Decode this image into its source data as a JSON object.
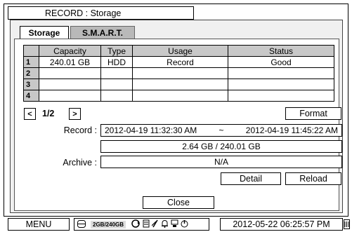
{
  "window": {
    "title": "RECORD : Storage"
  },
  "tabs": [
    {
      "label": "Storage",
      "active": true
    },
    {
      "label": "S.M.A.R.T.",
      "active": false
    }
  ],
  "table": {
    "headers": [
      "Capacity",
      "Type",
      "Usage",
      "Status"
    ],
    "rows": [
      {
        "index": "1",
        "capacity": "240.01 GB",
        "type": "HDD",
        "usage": "Record",
        "status": "Good"
      },
      {
        "index": "2",
        "capacity": "",
        "type": "",
        "usage": "",
        "status": ""
      },
      {
        "index": "3",
        "capacity": "",
        "type": "",
        "usage": "",
        "status": ""
      },
      {
        "index": "4",
        "capacity": "",
        "type": "",
        "usage": "",
        "status": ""
      }
    ]
  },
  "pagination": {
    "prev": "<",
    "page": "1/2",
    "next": ">"
  },
  "format_button": "Format",
  "record": {
    "label": "Record :",
    "start": "2012-04-19 11:32:30 AM",
    "separator": "~",
    "end": "2012-04-19 11:45:22 AM",
    "usage": "2.64 GB / 240.01 GB"
  },
  "archive": {
    "label": "Archive :",
    "value": "N/A"
  },
  "buttons": {
    "detail": "Detail",
    "reload": "Reload",
    "close": "Close"
  },
  "statusbar": {
    "menu": "MENU",
    "hdd_text": "2GB/240GB",
    "datetime": "2012-05-22 06:25:57 PM",
    "icons": [
      "hdd-icon",
      "network-icon",
      "record-icon",
      "mute-icon",
      "alarm-icon",
      "backup-icon",
      "power-icon",
      "sd-card-icon"
    ]
  }
}
